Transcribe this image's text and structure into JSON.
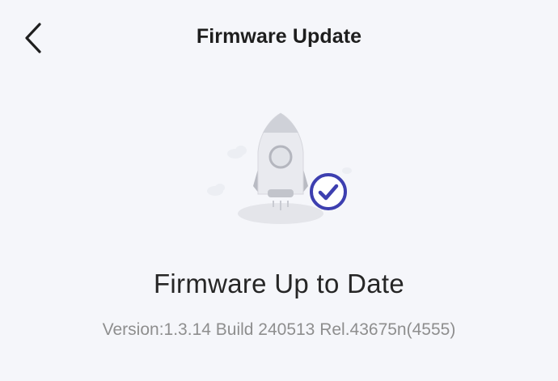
{
  "header": {
    "title": "Firmware Update",
    "back_icon": "chevron-left-icon"
  },
  "illustration": {
    "rocket_icon": "rocket-icon",
    "check_icon": "check-circle-icon",
    "accent_color": "#3d3fb0"
  },
  "status": {
    "title": "Firmware Up to Date",
    "version": "Version:1.3.14 Build 240513 Rel.43675n(4555)"
  }
}
